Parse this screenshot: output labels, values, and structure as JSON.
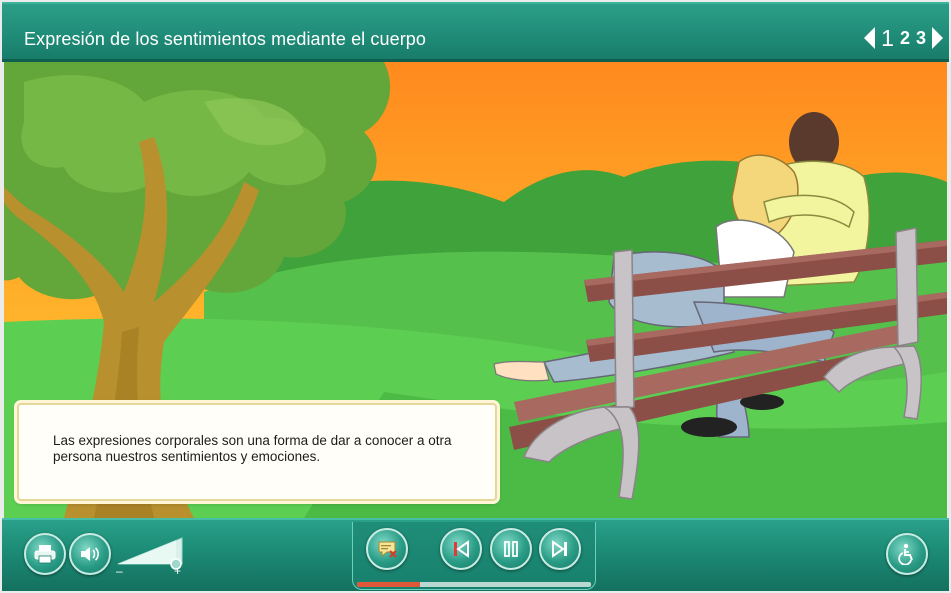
{
  "header": {
    "title": "Expresión de los sentimientos mediante el cuerpo",
    "pages": [
      "1",
      "2",
      "3"
    ],
    "current_page": 1
  },
  "caption": {
    "text": "Las expresiones corporales son una forma de dar a conocer a otra persona nuestros sentimientos y emociones."
  },
  "toolbar": {
    "print_icon": "printer-icon",
    "sound_icon": "speaker-icon",
    "volume_minus": "–",
    "volume_plus": "+",
    "volume_level": 0.85,
    "notes_icon": "notes-close-icon",
    "rewind_icon": "skip-back-icon",
    "pause_icon": "pause-icon",
    "forward_icon": "skip-forward-icon",
    "accessibility_icon": "accessibility-icon",
    "progress": 0.27
  },
  "colors": {
    "header": "#1f8c78",
    "caption_border": "#e6d69a",
    "progress": "#e0573a"
  }
}
